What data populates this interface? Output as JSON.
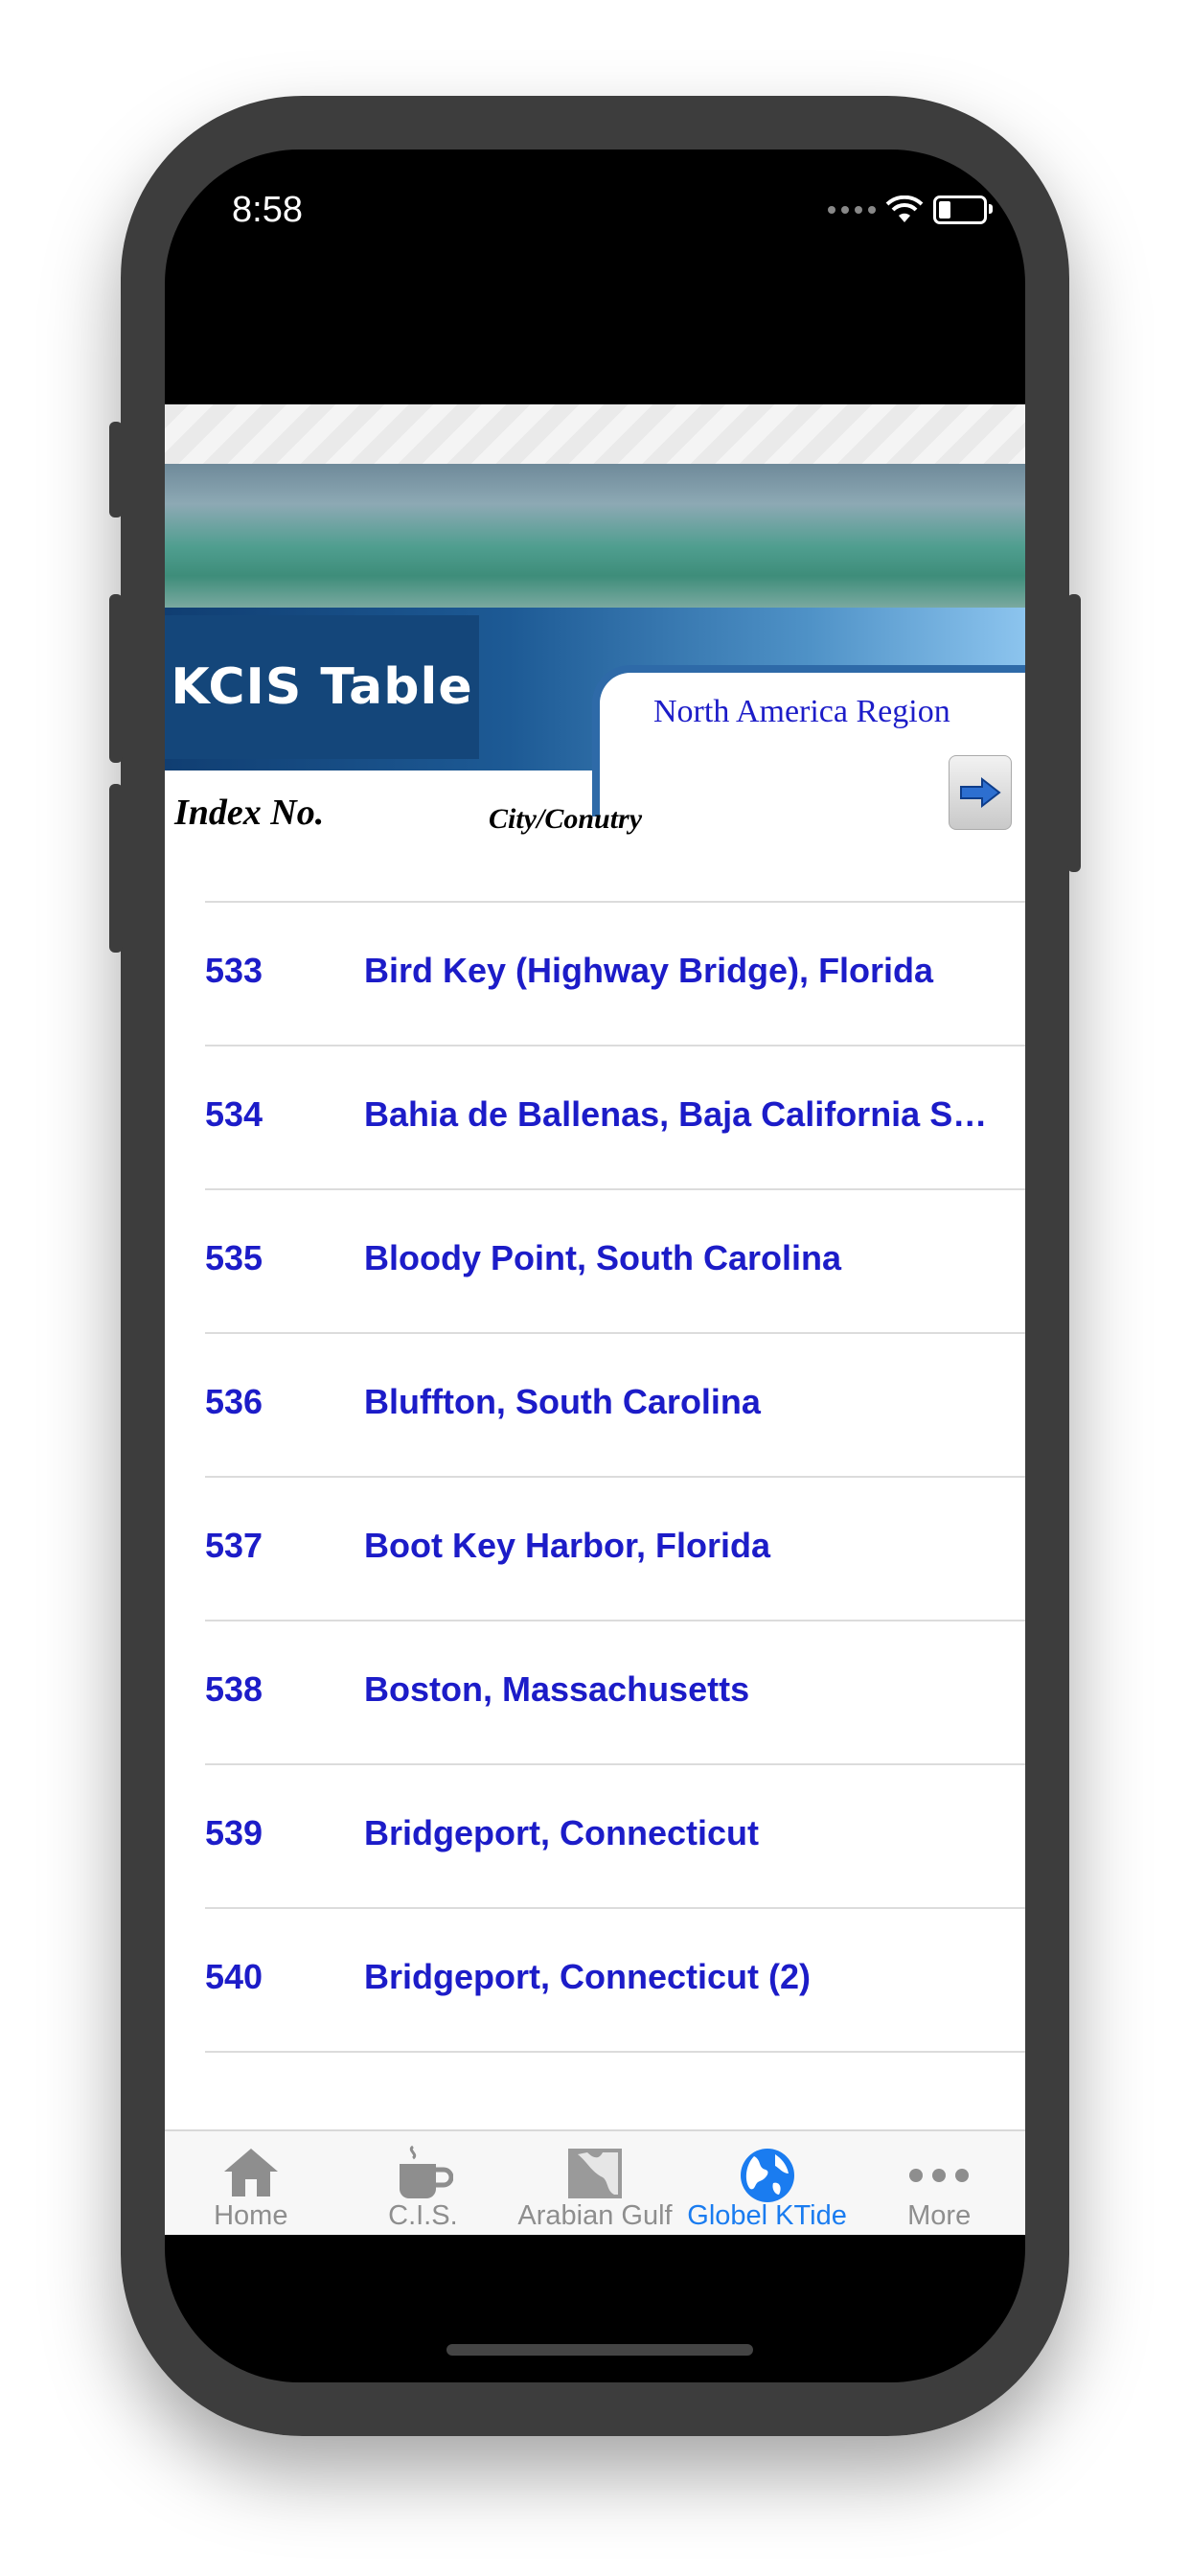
{
  "status_bar": {
    "time": "8:58"
  },
  "header": {
    "app_title": "KCIS Table",
    "region": "North America Region",
    "column_index": "Index No.",
    "column_city": "City/Conutry",
    "next_icon": "right-arrow-icon"
  },
  "list": {
    "rows": [
      {
        "index": "533",
        "city": "Bird Key (Highway Bridge), Florida"
      },
      {
        "index": "534",
        "city": "Bahia de Ballenas, Baja California Sur..."
      },
      {
        "index": "535",
        "city": "Bloody Point, South Carolina"
      },
      {
        "index": "536",
        "city": "Bluffton, South Carolina"
      },
      {
        "index": "537",
        "city": "Boot Key Harbor, Florida"
      },
      {
        "index": "538",
        "city": "Boston, Massachusetts"
      },
      {
        "index": "539",
        "city": "Bridgeport, Connecticut"
      },
      {
        "index": "540",
        "city": "Bridgeport, Connecticut (2)"
      }
    ]
  },
  "tabbar": {
    "tabs": [
      {
        "label": "Home",
        "icon": "house-icon",
        "active": false
      },
      {
        "label": "C.I.S.",
        "icon": "coffee-cup-icon",
        "active": false
      },
      {
        "label": "Arabian Gulf",
        "icon": "map-icon",
        "active": false
      },
      {
        "label": "Globel KTide",
        "icon": "globe-icon",
        "active": true
      },
      {
        "label": "More",
        "icon": "more-dots-icon",
        "active": false
      }
    ]
  },
  "colors": {
    "link_text": "#1c1cc8",
    "tab_active": "#1a7cf0",
    "tab_inactive": "#8e8e8e",
    "header_band": "#14467a"
  }
}
